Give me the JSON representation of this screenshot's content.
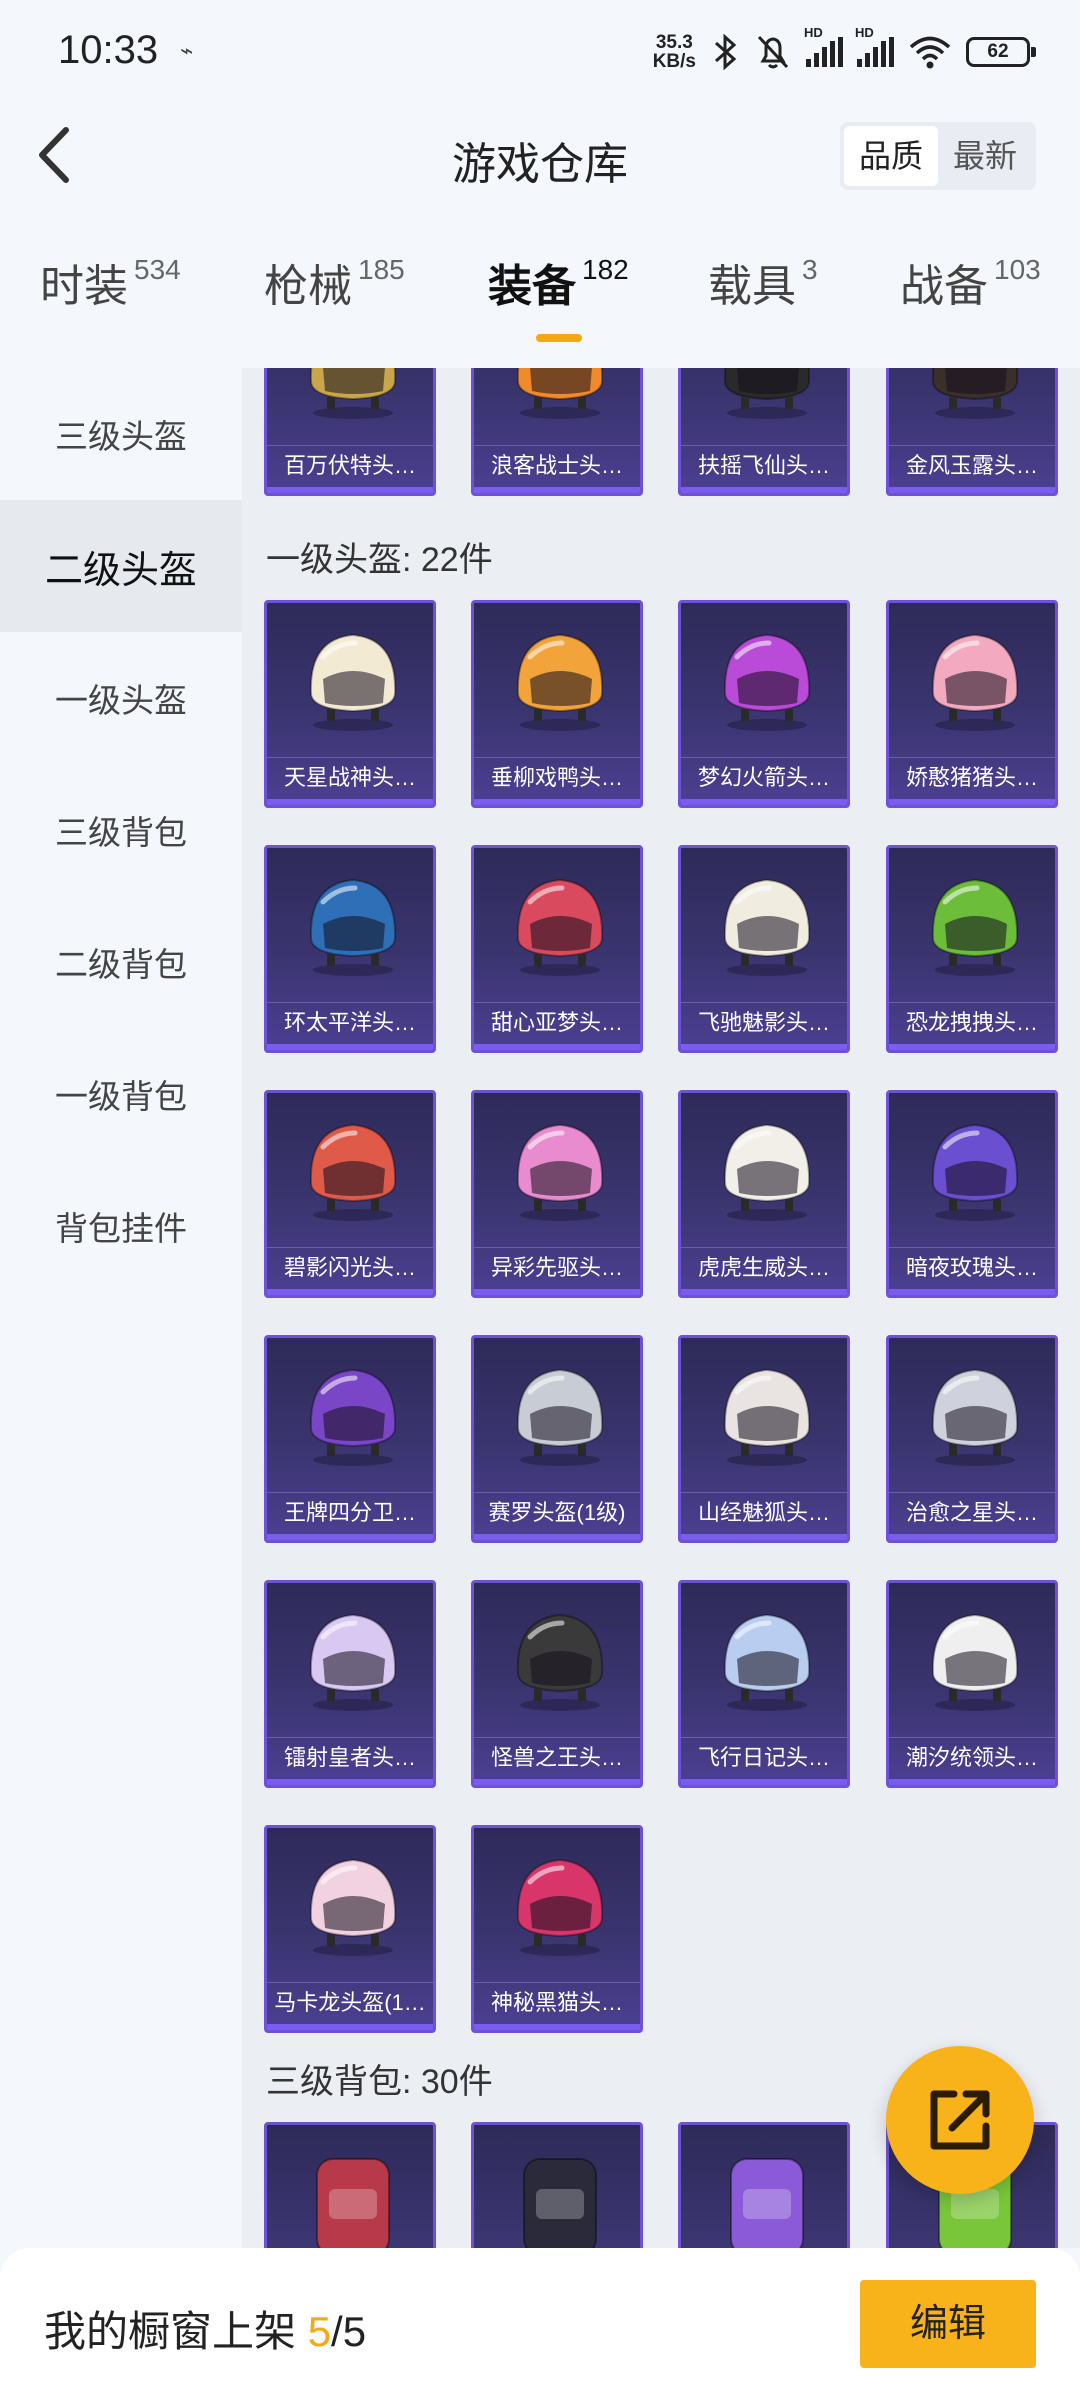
{
  "status_bar": {
    "time": "10:33",
    "net_speed_value": "35.3",
    "net_speed_unit": "KB/s",
    "battery": "62",
    "hd_label": "HD"
  },
  "header": {
    "title": "游戏仓库",
    "sort_options": [
      "品质",
      "最新"
    ],
    "active_sort": "品质"
  },
  "category_tabs": [
    {
      "label": "时装",
      "count": "534"
    },
    {
      "label": "枪械",
      "count": "185"
    },
    {
      "label": "装备",
      "count": "182",
      "active": true
    },
    {
      "label": "载具",
      "count": "3"
    },
    {
      "label": "战备",
      "count": "103"
    }
  ],
  "sidebar": {
    "items": [
      "三级头盔",
      "二级头盔",
      "一级头盔",
      "三级背包",
      "二级背包",
      "一级背包",
      "背包挂件"
    ],
    "active_index": 1
  },
  "sections": {
    "top_row": {
      "items": [
        "百万伏特头…",
        "浪客战士头…",
        "扶摇飞仙头…",
        "金风玉露头…"
      ]
    },
    "level1_helmets": {
      "title": "一级头盔: 22件",
      "items": [
        "天星战神头…",
        "垂柳戏鸭头…",
        "梦幻火箭头…",
        "娇憨猪猪头…",
        "环太平洋头…",
        "甜心亚梦头…",
        "飞驰魅影头…",
        "恐龙拽拽头…",
        "碧影闪光头…",
        "异彩先驱头…",
        "虎虎生威头…",
        "暗夜玫瑰头…",
        "王牌四分卫…",
        "赛罗头盔(1级)",
        "山经魅狐头…",
        "治愈之星头…",
        "镭射皇者头…",
        "怪兽之王头…",
        "飞行日记头…",
        "潮汐统领头…",
        "马卡龙头盔(1…",
        "神秘黑猫头…"
      ]
    },
    "level3_backpacks": {
      "title": "三级背包: 30件"
    }
  },
  "helmet_colors": [
    "#c9a64a",
    "#f08a2a",
    "#2a2a2a",
    "#3a2f2a",
    "#f3ead4",
    "#f2a33a",
    "#b94bd8",
    "#f3a9bf",
    "#2e6fb8",
    "#d94a5e",
    "#f0ece0",
    "#6bbd3a",
    "#e05a4a",
    "#e98ccf",
    "#f2eee8",
    "#6a4fd0",
    "#7a46c8",
    "#c8ccd4",
    "#e9e4e2",
    "#cfd2dc",
    "#d8c8f2",
    "#3a3a3a",
    "#b8cdf0",
    "#efefef",
    "#f2d2e0",
    "#d8356a"
  ],
  "bottom_bar": {
    "label": "我的橱窗上架",
    "count": "5",
    "separator": "/",
    "total": "5",
    "edit_label": "编辑"
  },
  "accent_color": "#f8b21a",
  "card_color": "#3b3570"
}
